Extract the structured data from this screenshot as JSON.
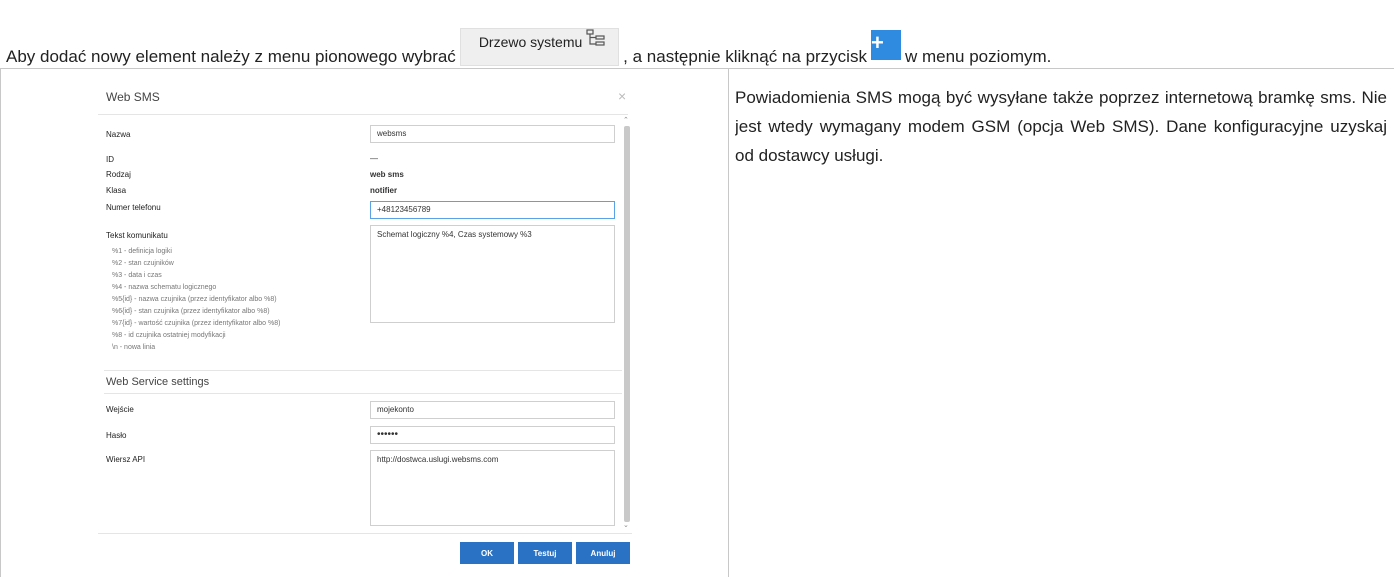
{
  "instruction": {
    "part1": "Aby dodać nowy element należy z menu pionowego wybrać",
    "tree_button": "Drzewo systemu",
    "part2": ", a następnie kliknąć na przycisk",
    "plus_button": "+",
    "part3": "w menu poziomym."
  },
  "description": "Powiadomienia SMS mogą być wysyłane także poprzez internetową bramkę sms. Nie jest wtedy wymagany modem GSM (opcja Web SMS). Dane konfiguracyjne uzyskaj od dostawcy usługi.",
  "dialog": {
    "title": "Web SMS",
    "close": "×",
    "fields": {
      "name_label": "Nazwa",
      "name_value": "websms",
      "id_label": "ID",
      "id_value": "—",
      "kind_label": "Rodzaj",
      "kind_value": "web sms",
      "class_label": "Klasa",
      "class_value": "notifier",
      "phone_label": "Numer telefonu",
      "phone_value": "+48123456789",
      "message_label": "Tekst komunikatu",
      "message_value": "Schemat logiczny %4, Czas systemowy %3"
    },
    "hints": [
      "%1 - definicja logiki",
      "%2 - stan czujników",
      "%3 - data i czas",
      "%4 - nazwa schematu logicznego",
      "%5{id} - nazwa czujnika (przez identyfikator albo %8)",
      "%6{id} - stan czujnika (przez identyfikator albo %8)",
      "%7{id} - wartość czujnika (przez identyfikator albo %8)",
      "%8 - id czujnika ostatniej modyfikacji",
      "\\n - nowa linia"
    ],
    "section_title": "Web Service settings",
    "service": {
      "login_label": "Wejście",
      "login_value": "mojekonto",
      "password_label": "Hasło",
      "password_value": "••••••",
      "api_label": "Wiersz API",
      "api_value": "http://dostwca.uslugi.websms.com"
    },
    "buttons": {
      "ok": "OK",
      "test": "Testuj",
      "cancel": "Anuluj"
    }
  },
  "colors": {
    "accent": "#2a72c3",
    "plus": "#2f8be0",
    "focus": "#5aa2e6"
  }
}
